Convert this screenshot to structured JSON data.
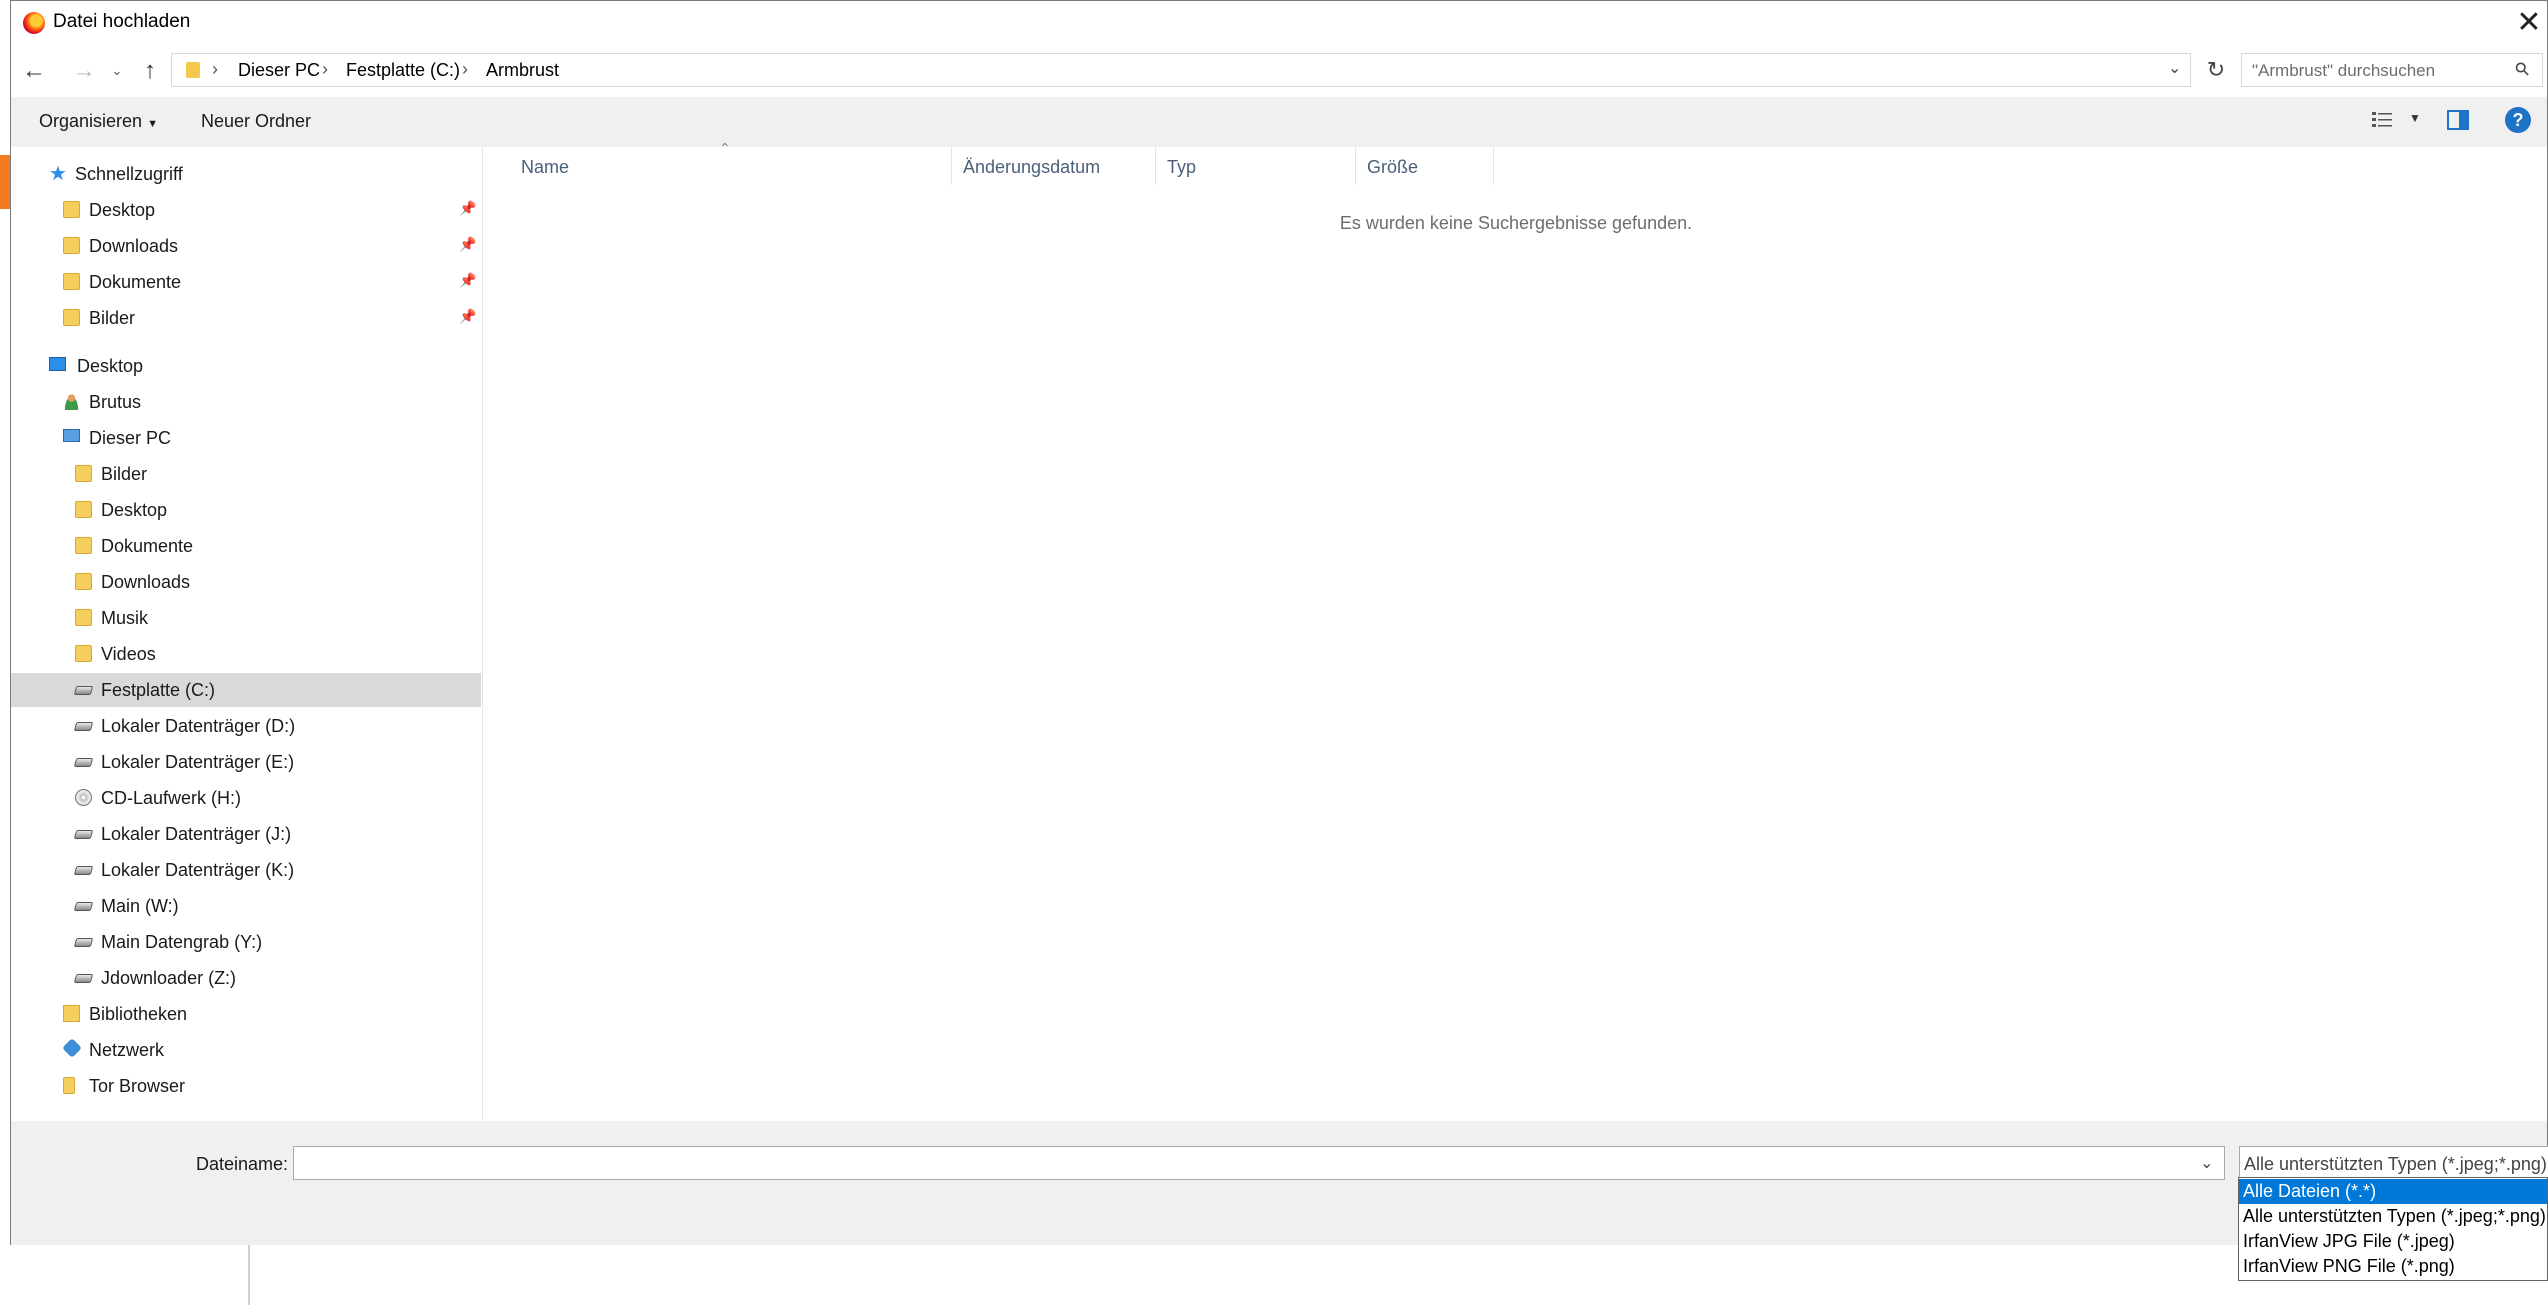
{
  "dialog": {
    "title": "Datei hochladen"
  },
  "address": {
    "crumbs": [
      "Dieser PC",
      "Festplatte (C:)",
      "Armbrust"
    ]
  },
  "search": {
    "placeholder": "\"Armbrust\" durchsuchen"
  },
  "toolbar": {
    "organize": "Organisieren",
    "new_folder": "Neuer Ordner"
  },
  "nav": {
    "quick_access": "Schnellzugriff",
    "quick_items": [
      "Desktop",
      "Downloads",
      "Dokumente",
      "Bilder"
    ],
    "tree": [
      {
        "label": "Desktop",
        "icon": "monitor"
      },
      {
        "label": "Brutus",
        "icon": "user"
      },
      {
        "label": "Dieser PC",
        "icon": "pc"
      },
      {
        "label": "Bilder",
        "icon": "folder"
      },
      {
        "label": "Desktop",
        "icon": "folder"
      },
      {
        "label": "Dokumente",
        "icon": "folder"
      },
      {
        "label": "Downloads",
        "icon": "folder"
      },
      {
        "label": "Musik",
        "icon": "folder"
      },
      {
        "label": "Videos",
        "icon": "folder"
      },
      {
        "label": "Festplatte (C:)",
        "icon": "drive"
      },
      {
        "label": "Lokaler Datenträger (D:)",
        "icon": "drive"
      },
      {
        "label": "Lokaler Datenträger (E:)",
        "icon": "drive"
      },
      {
        "label": "CD-Laufwerk (H:)",
        "icon": "cd"
      },
      {
        "label": "Lokaler Datenträger (J:)",
        "icon": "drive"
      },
      {
        "label": "Lokaler Datenträger (K:)",
        "icon": "drive"
      },
      {
        "label": "Main (W:)",
        "icon": "drive"
      },
      {
        "label": "Main Datengrab (Y:)",
        "icon": "drive"
      },
      {
        "label": "Jdownloader (Z:)",
        "icon": "drive"
      },
      {
        "label": "Bibliotheken",
        "icon": "library"
      },
      {
        "label": "Netzwerk",
        "icon": "network"
      },
      {
        "label": "Tor Browser",
        "icon": "folder"
      }
    ]
  },
  "columns": {
    "name": "Name",
    "date": "Änderungsdatum",
    "type": "Typ",
    "size": "Größe"
  },
  "content": {
    "empty_message": "Es wurden keine Suchergebnisse gefunden."
  },
  "bottom": {
    "filename_label": "Dateiname:",
    "filename_value": "",
    "filetype_value": "Alle unterstützten Typen (*.jpeg;*.png)",
    "filetype_options": [
      "Alle Dateien (*.*)",
      "Alle unterstützten Typen (*.jpeg;*.png)",
      "IrfanView JPG File (*.jpeg)",
      "IrfanView PNG File (*.png)"
    ],
    "highlighted_option": "Alle Dateien (*.*)"
  },
  "colors": {
    "accent": "#0078d7",
    "selection": "#d9d9d9"
  }
}
